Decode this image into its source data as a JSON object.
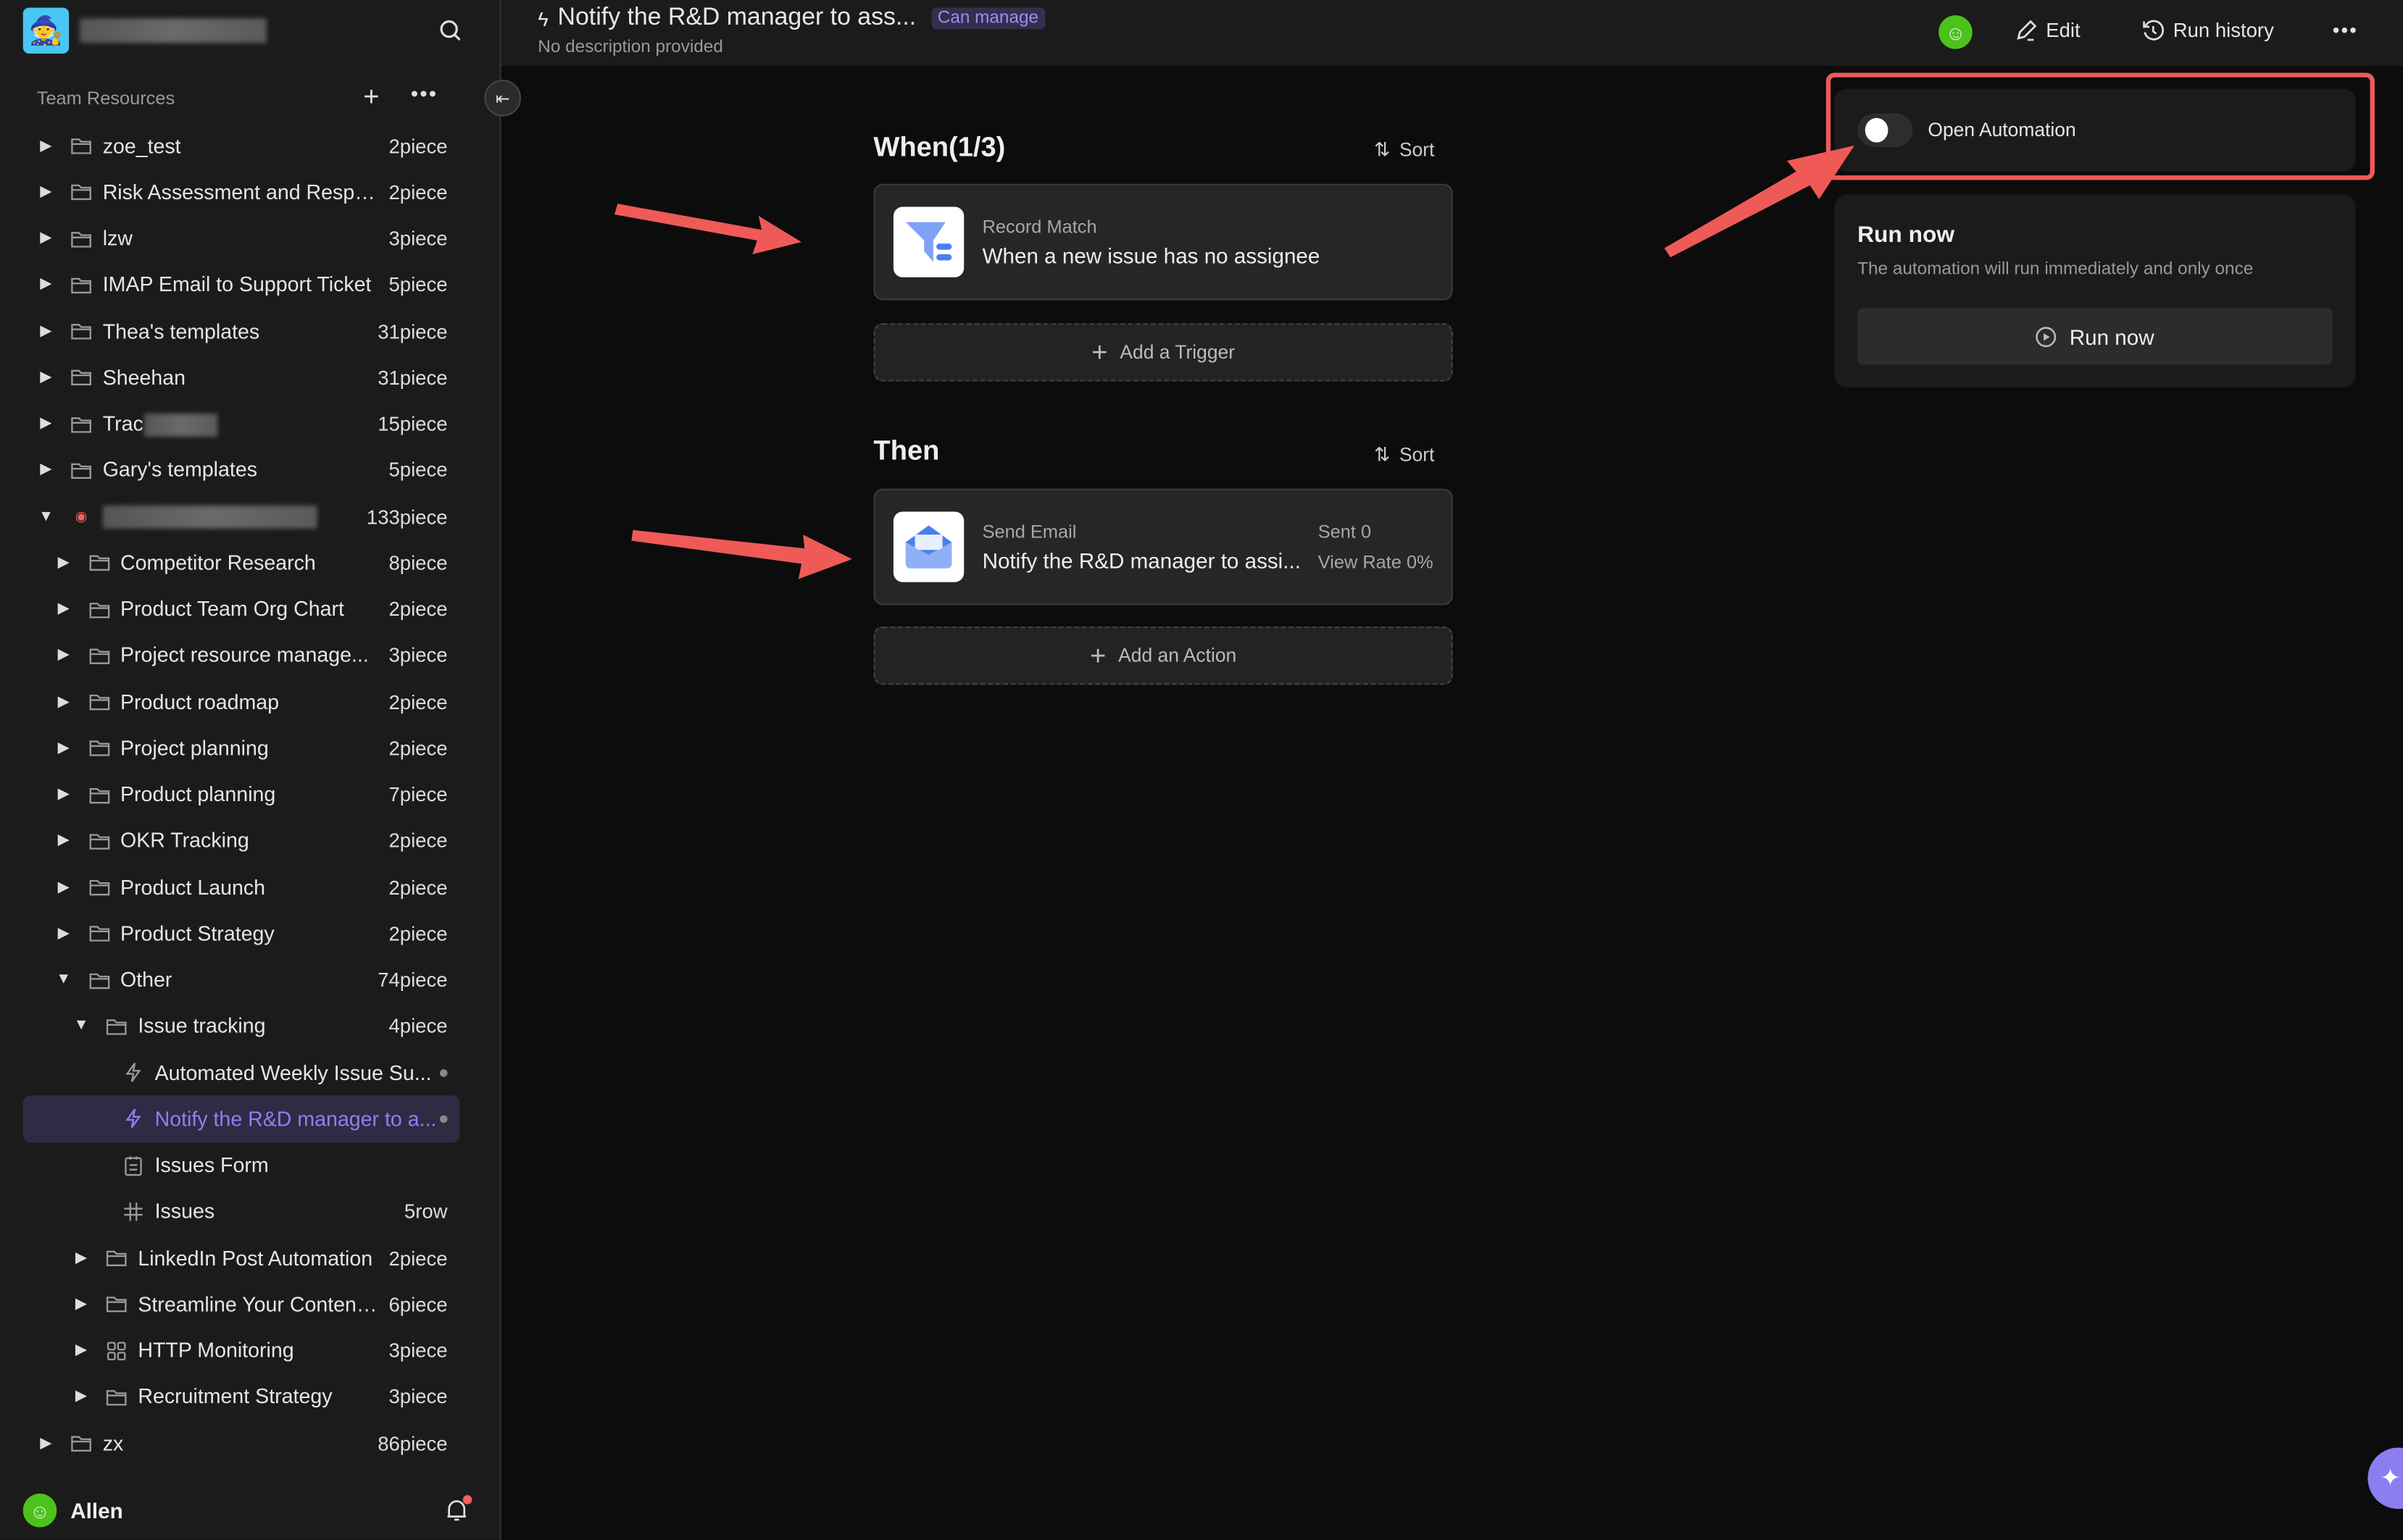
{
  "sidebar": {
    "section_label": "Team Resources",
    "user": {
      "name": "Allen"
    },
    "items": [
      {
        "level": 0,
        "caret": "closed",
        "icon": "folder",
        "label": "zoe_test",
        "count": "2piece"
      },
      {
        "level": 0,
        "caret": "closed",
        "icon": "folder",
        "label": "Risk Assessment and Respo...",
        "count": "2piece"
      },
      {
        "level": 0,
        "caret": "closed",
        "icon": "folder",
        "label": "lzw",
        "count": "3piece"
      },
      {
        "level": 0,
        "caret": "closed",
        "icon": "folder",
        "label": "IMAP Email to Support Ticket",
        "count": "5piece"
      },
      {
        "level": 0,
        "caret": "closed",
        "icon": "folder",
        "label": "Thea's templates",
        "count": "31piece"
      },
      {
        "level": 0,
        "caret": "closed",
        "icon": "folder",
        "label": "Sheehan",
        "count": "31piece"
      },
      {
        "level": 0,
        "caret": "closed",
        "icon": "folder",
        "label": "Trac",
        "count": "15piece",
        "blurred": true
      },
      {
        "level": 0,
        "caret": "closed",
        "icon": "folder",
        "label": "Gary's templates",
        "count": "5piece"
      },
      {
        "level": 0,
        "caret": "open",
        "icon": "emoji",
        "label": "",
        "count": "133piece",
        "blurred": true
      },
      {
        "level": 1,
        "caret": "closed",
        "icon": "folder",
        "label": "Competitor Research",
        "count": "8piece"
      },
      {
        "level": 1,
        "caret": "closed",
        "icon": "folder",
        "label": "Product Team Org Chart",
        "count": "2piece"
      },
      {
        "level": 1,
        "caret": "closed",
        "icon": "folder",
        "label": "Project resource manage...",
        "count": "3piece"
      },
      {
        "level": 1,
        "caret": "closed",
        "icon": "folder",
        "label": "Product roadmap",
        "count": "2piece"
      },
      {
        "level": 1,
        "caret": "closed",
        "icon": "folder",
        "label": "Project planning",
        "count": "2piece"
      },
      {
        "level": 1,
        "caret": "closed",
        "icon": "folder",
        "label": "Product planning",
        "count": "7piece"
      },
      {
        "level": 1,
        "caret": "closed",
        "icon": "folder",
        "label": "OKR Tracking",
        "count": "2piece"
      },
      {
        "level": 1,
        "caret": "closed",
        "icon": "folder",
        "label": "Product Launch",
        "count": "2piece"
      },
      {
        "level": 1,
        "caret": "closed",
        "icon": "folder",
        "label": "Product Strategy",
        "count": "2piece"
      },
      {
        "level": 1,
        "caret": "open",
        "icon": "folder",
        "label": "Other",
        "count": "74piece"
      },
      {
        "level": 2,
        "caret": "open",
        "icon": "folder",
        "label": "Issue tracking",
        "count": "4piece"
      },
      {
        "level": 3,
        "caret": "none",
        "icon": "bolt",
        "label": "Automated Weekly Issue Su...",
        "count": "",
        "dot": true
      },
      {
        "level": 3,
        "caret": "none",
        "icon": "bolt",
        "label": "Notify the R&D manager to a...",
        "count": "",
        "dot": true,
        "selected": true
      },
      {
        "level": 3,
        "caret": "none",
        "icon": "form",
        "label": "Issues Form",
        "count": ""
      },
      {
        "level": 3,
        "caret": "none",
        "icon": "hash",
        "label": "Issues",
        "count": "5row"
      },
      {
        "level": 2,
        "caret": "closed",
        "icon": "folder",
        "label": "LinkedIn Post Automation",
        "count": "2piece"
      },
      {
        "level": 2,
        "caret": "closed",
        "icon": "folder",
        "label": "Streamline Your Content...",
        "count": "6piece"
      },
      {
        "level": 2,
        "caret": "closed",
        "icon": "grid",
        "label": "HTTP Monitoring",
        "count": "3piece"
      },
      {
        "level": 2,
        "caret": "closed",
        "icon": "folder",
        "label": "Recruitment Strategy",
        "count": "3piece"
      },
      {
        "level": 0,
        "caret": "closed",
        "icon": "folder",
        "label": "zx",
        "count": "86piece"
      }
    ]
  },
  "header": {
    "title": "Notify the R&D manager to ass...",
    "permission": "Can manage",
    "description": "No description provided",
    "edit_label": "Edit",
    "run_history_label": "Run history"
  },
  "when": {
    "title": "When(1/3)",
    "sort_label": "Sort",
    "trigger": {
      "kind": "Record Match",
      "text": "When a new issue has no assignee"
    },
    "add_label": "Add a Trigger"
  },
  "then": {
    "title": "Then",
    "sort_label": "Sort",
    "action": {
      "kind": "Send Email",
      "text": "Notify the R&D manager to assi...",
      "sent": "Sent 0",
      "view_rate": "View Rate 0%"
    },
    "add_label": "Add an Action"
  },
  "automation_toggle": {
    "label": "Open Automation",
    "on": false
  },
  "run_now": {
    "title": "Run now",
    "description": "The automation will run immediately and only once",
    "button_label": "Run now"
  },
  "colors": {
    "accent": "#8f7ff0",
    "annotation": "#ef5a57",
    "background": "#0c0c0c",
    "panel": "#1b1b1b"
  }
}
